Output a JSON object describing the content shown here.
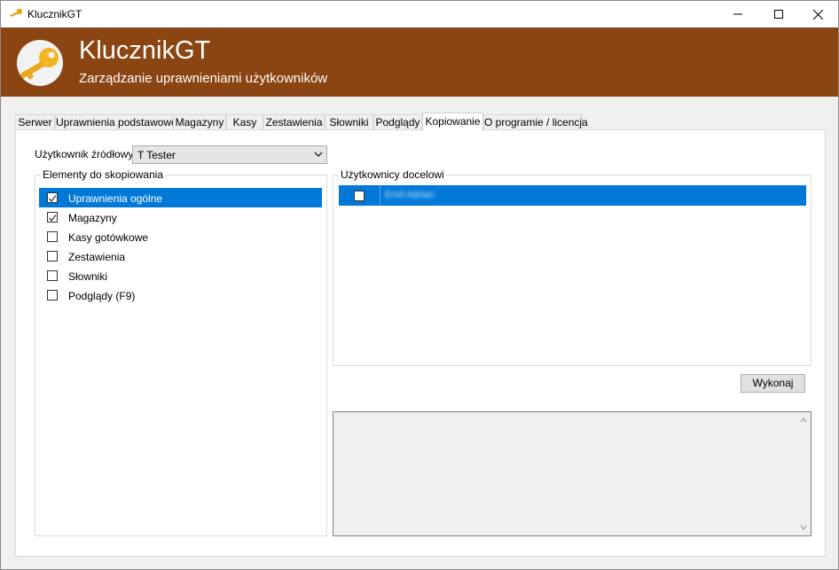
{
  "window": {
    "title": "KlucznikGT"
  },
  "window_controls": {
    "minimize": "minimize-icon",
    "maximize": "maximize-icon",
    "close": "close-icon"
  },
  "banner": {
    "app_name": "KlucznikGT",
    "subtitle": "Zarządzanie uprawnieniami użytkowników",
    "color": "#8b4513",
    "logo_icon": "key-icon"
  },
  "tabs": [
    {
      "label": "Serwer"
    },
    {
      "label": "Uprawnienia podstawowe"
    },
    {
      "label": "Magazyny"
    },
    {
      "label": "Kasy"
    },
    {
      "label": "Zestawienia"
    },
    {
      "label": "Słowniki"
    },
    {
      "label": "Podglądy"
    },
    {
      "label": "Kopiowanie",
      "active": true
    },
    {
      "label": "O programie / licencja"
    }
  ],
  "copy": {
    "source_label": "Użytkownik źródłowy",
    "source_value": "T Tester",
    "elements_group_label": "Elementy do skopiowania",
    "elements": [
      {
        "label": "Uprawnienia ogólne",
        "checked": true,
        "selected": true
      },
      {
        "label": "Magazyny",
        "checked": true,
        "selected": false
      },
      {
        "label": "Kasy gotówkowe",
        "checked": false,
        "selected": false
      },
      {
        "label": "Zestawienia",
        "checked": false,
        "selected": false
      },
      {
        "label": "Słowniki",
        "checked": false,
        "selected": false
      },
      {
        "label": "Podglądy (F9)",
        "checked": false,
        "selected": false
      }
    ],
    "targets_group_label": "Użytkownicy docelowi",
    "targets": [
      {
        "name": "Emil Adrian",
        "checked": false,
        "selected": true
      }
    ],
    "execute_button": "Wykonaj",
    "log_text": ""
  },
  "colors": {
    "selection": "#0078d7"
  }
}
